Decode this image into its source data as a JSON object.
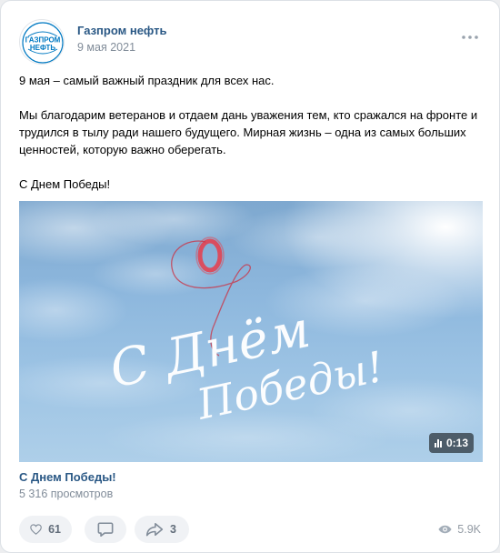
{
  "post": {
    "author": "Газпром нефть",
    "date": "9 мая 2021",
    "avatar_text_line1": "ГАЗПРОМ",
    "avatar_text_line2": "НЕФТЬ",
    "paragraphs": [
      "9 мая – самый важный праздник для всех нас.",
      "Мы благодарим ветеранов и отдаем дань уважения тем, кто сражался на фронте и трудился в тылу ради нашего будущего. Мирная жизнь – одна из самых больших ценностей, которую важно оберегать.",
      "С Днем Победы!"
    ]
  },
  "video": {
    "overlay_line1": "С Днём",
    "overlay_line2": "Победы!",
    "duration": "0:13",
    "title": "С Днем Победы!",
    "views": "5 316 просмотров"
  },
  "actions": {
    "likes": "61",
    "shares": "3",
    "views": "5.9K"
  },
  "colors": {
    "link": "#2a5885",
    "muted": "#818c99",
    "brand_blue": "#0079c2",
    "pill_bg": "#f0f2f5"
  }
}
